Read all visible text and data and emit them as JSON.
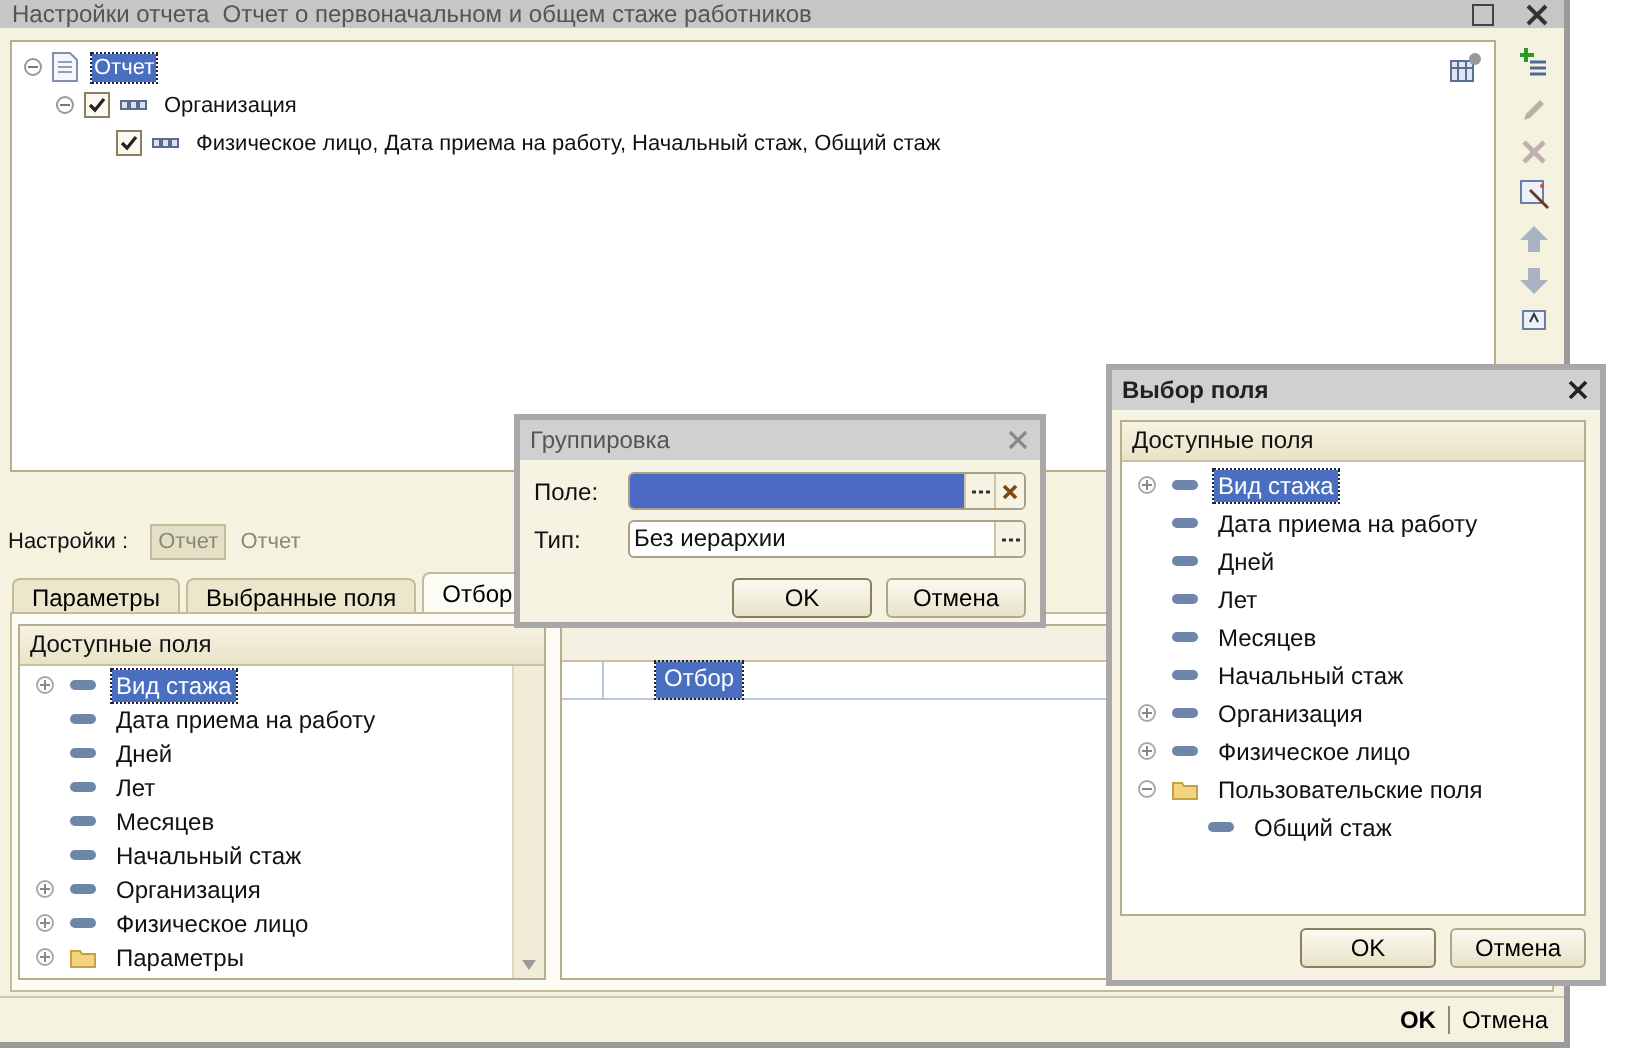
{
  "window": {
    "title": "Настройки отчета  Отчет о первоначальном и общем стаже работников"
  },
  "structure_tree": [
    {
      "label": "Отчет",
      "kind": "report",
      "expanded": true,
      "selected": true,
      "children": [
        {
          "label": "Организация",
          "kind": "grouping",
          "checked": true,
          "expanded": true,
          "selected": false,
          "children": [
            {
              "label": "Физическое лицо, Дата приема на работу, Начальный стаж, Общий стаж",
              "kind": "grouping",
              "checked": true,
              "selected": false
            }
          ]
        }
      ]
    }
  ],
  "settings": {
    "label": "Настройки :",
    "variants": [
      {
        "label": "Отчет",
        "selected": true
      },
      {
        "label": "Отчет",
        "selected": false
      }
    ]
  },
  "tabs": [
    {
      "label": "Параметры",
      "selected": false
    },
    {
      "label": "Выбранные поля",
      "selected": false
    },
    {
      "label": "Отбор",
      "selected": true
    }
  ],
  "available_fields": {
    "header": "Доступные поля",
    "items": [
      {
        "label": "Вид стажа",
        "kind": "field",
        "expanded": false,
        "selected": true
      },
      {
        "label": "Дата приема на работу",
        "kind": "field",
        "selected": false
      },
      {
        "label": "Дней",
        "kind": "field",
        "selected": false
      },
      {
        "label": "Лет",
        "kind": "field",
        "selected": false
      },
      {
        "label": "Месяцев",
        "kind": "field",
        "selected": false
      },
      {
        "label": "Начальный стаж",
        "kind": "field",
        "selected": false
      },
      {
        "label": "Организация",
        "kind": "field",
        "expanded": false,
        "selected": false
      },
      {
        "label": "Физическое лицо",
        "kind": "field",
        "expanded": false,
        "selected": false
      },
      {
        "label": "Параметры",
        "kind": "folder",
        "expanded": false,
        "selected": false
      }
    ]
  },
  "filter_table": {
    "rows": [
      {
        "label": "Отбор",
        "selected": true
      }
    ]
  },
  "buttons": [
    {
      "label": "OK",
      "default": true
    },
    {
      "label": "Отмена",
      "default": false
    }
  ],
  "grouping_dialog": {
    "title": "Группировка",
    "fields": [
      {
        "label": "Поле:",
        "selected": true,
        "clearable": true
      },
      {
        "label": "Тип:",
        "value": "Без иерархии",
        "selected": false,
        "clearable": false
      }
    ],
    "buttons": [
      {
        "label": "OK",
        "default": true
      },
      {
        "label": "Отмена",
        "default": false
      }
    ]
  },
  "field_dialog": {
    "title": "Выбор поля",
    "header": "Доступные поля",
    "items": [
      {
        "label": "Вид стажа",
        "kind": "field",
        "expanded": false,
        "selected": true
      },
      {
        "label": "Дата приема на работу",
        "kind": "field",
        "selected": false
      },
      {
        "label": "Дней",
        "kind": "field",
        "selected": false
      },
      {
        "label": "Лет",
        "kind": "field",
        "selected": false
      },
      {
        "label": "Месяцев",
        "kind": "field",
        "selected": false
      },
      {
        "label": "Начальный стаж",
        "kind": "field",
        "selected": false
      },
      {
        "label": "Организация",
        "kind": "field",
        "expanded": false,
        "selected": false
      },
      {
        "label": "Физическое лицо",
        "kind": "field",
        "expanded": false,
        "selected": false
      },
      {
        "label": "Пользовательские поля",
        "kind": "folder",
        "expanded": true,
        "selected": false,
        "children": [
          {
            "label": "Общий стаж",
            "kind": "field",
            "selected": false
          }
        ]
      }
    ],
    "buttons": [
      {
        "label": "OK",
        "default": true
      },
      {
        "label": "Отмена",
        "default": false
      }
    ]
  }
}
